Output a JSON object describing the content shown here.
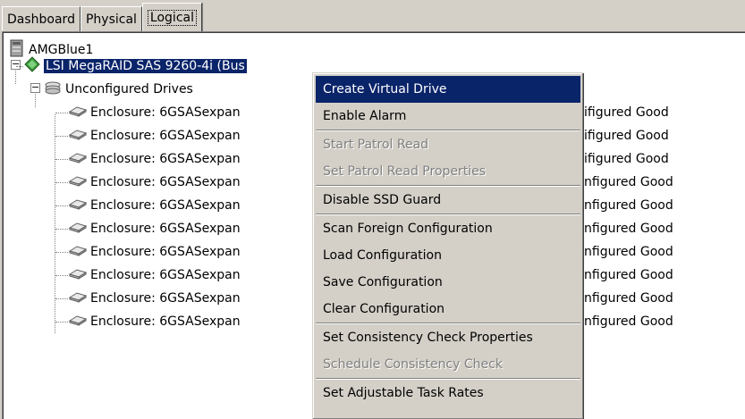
{
  "tabs": [
    {
      "label": "Dashboard",
      "active": false
    },
    {
      "label": "Physical",
      "active": false
    },
    {
      "label": "Logical",
      "active": true
    }
  ],
  "tree": {
    "root": {
      "label": "AMGBlue1",
      "icon": "server-icon"
    },
    "controller": {
      "label": "LSI MegaRAID SAS 9260-4i (Bus",
      "icon": "controller-icon",
      "selected": true
    },
    "group": {
      "label": "Unconfigured Drives",
      "icon": "drive-group-icon"
    },
    "drives": [
      {
        "label": "Enclosure: 6GSASexpan",
        "status": "ifigured Good"
      },
      {
        "label": "Enclosure: 6GSASexpan",
        "status": "ifigured Good"
      },
      {
        "label": "Enclosure: 6GSASexpan",
        "status": "ifigured Good"
      },
      {
        "label": "Enclosure: 6GSASexpan",
        "status": "nfigured Good"
      },
      {
        "label": "Enclosure: 6GSASexpan",
        "status": "nfigured Good"
      },
      {
        "label": "Enclosure: 6GSASexpan",
        "status": "nfigured Good"
      },
      {
        "label": "Enclosure: 6GSASexpan",
        "status": "nfigured Good"
      },
      {
        "label": "Enclosure: 6GSASexpan",
        "status": "nfigured Good"
      },
      {
        "label": "Enclosure: 6GSASexpan",
        "status": "nfigured Good"
      },
      {
        "label": "Enclosure: 6GSASexpan",
        "status": "nfigured Good"
      }
    ]
  },
  "context_menu": {
    "items": [
      {
        "label": "Create Virtual Drive",
        "state": "highlighted"
      },
      {
        "label": "Enable Alarm",
        "state": "enabled"
      },
      {
        "separator": true
      },
      {
        "label": "Start Patrol Read",
        "state": "disabled"
      },
      {
        "label": "Set Patrol Read Properties",
        "state": "disabled"
      },
      {
        "separator": true
      },
      {
        "label": "Disable SSD Guard",
        "state": "enabled"
      },
      {
        "separator": true
      },
      {
        "label": "Scan Foreign Configuration",
        "state": "enabled"
      },
      {
        "label": "Load Configuration",
        "state": "enabled"
      },
      {
        "label": "Save Configuration",
        "state": "enabled"
      },
      {
        "label": "Clear Configuration",
        "state": "enabled"
      },
      {
        "separator": true
      },
      {
        "label": "Set Consistency Check Properties",
        "state": "enabled"
      },
      {
        "label": "Schedule Consistency Check",
        "state": "disabled"
      },
      {
        "separator": true
      },
      {
        "label": "Set Adjustable Task Rates",
        "state": "enabled"
      }
    ]
  },
  "colors": {
    "selection": "#0a246a",
    "window": "#d4d0c8",
    "disabled_text": "#808080"
  }
}
